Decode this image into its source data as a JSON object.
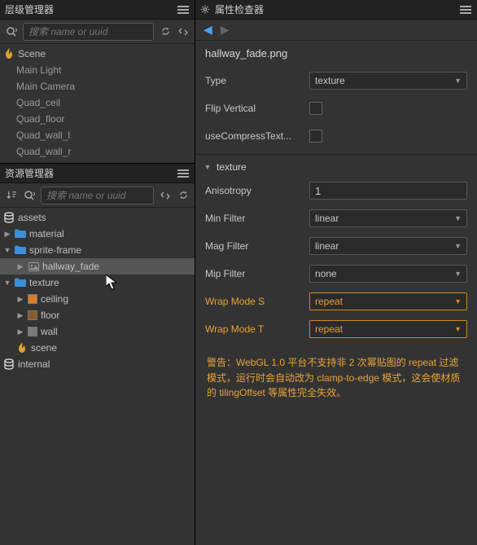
{
  "panels": {
    "hierarchy_title": "层级管理器",
    "assets_title": "资源管理器",
    "inspector_title": "属性检查器"
  },
  "search": {
    "placeholder": "搜索 name or uuid"
  },
  "hierarchy": {
    "root": "Scene",
    "items": [
      "Main Light",
      "Main Camera",
      "Quad_ceil",
      "Quad_floor",
      "Quad_wall_l",
      "Quad_wall_r"
    ]
  },
  "assets": {
    "root": "assets",
    "material": "material",
    "sprite_frame": "sprite-frame",
    "hallway_fade": "hallway_fade",
    "texture": "texture",
    "tex_items": [
      "ceiling",
      "floor",
      "wall"
    ],
    "scene": "scene",
    "internal": "internal"
  },
  "inspector": {
    "asset_name": "hallway_fade.png",
    "props": {
      "type_label": "Type",
      "type_value": "texture",
      "flip_label": "Flip Vertical",
      "compress_label": "useCompressText...",
      "section": "texture",
      "aniso_label": "Anisotropy",
      "aniso_value": "1",
      "minf_label": "Min Filter",
      "minf_value": "linear",
      "magf_label": "Mag Filter",
      "magf_value": "linear",
      "mipf_label": "Mip Filter",
      "mipf_value": "none",
      "wraps_label": "Wrap Mode S",
      "wraps_value": "repeat",
      "wrapt_label": "Wrap Mode T",
      "wrapt_value": "repeat"
    },
    "warning": "警告：WebGL 1.0 平台不支持非 2 次幂贴图的 repeat 过滤模式，运行时会自动改为 clamp-to-edge 模式，这会使材质的 tilingOffset 等属性完全失效。"
  }
}
